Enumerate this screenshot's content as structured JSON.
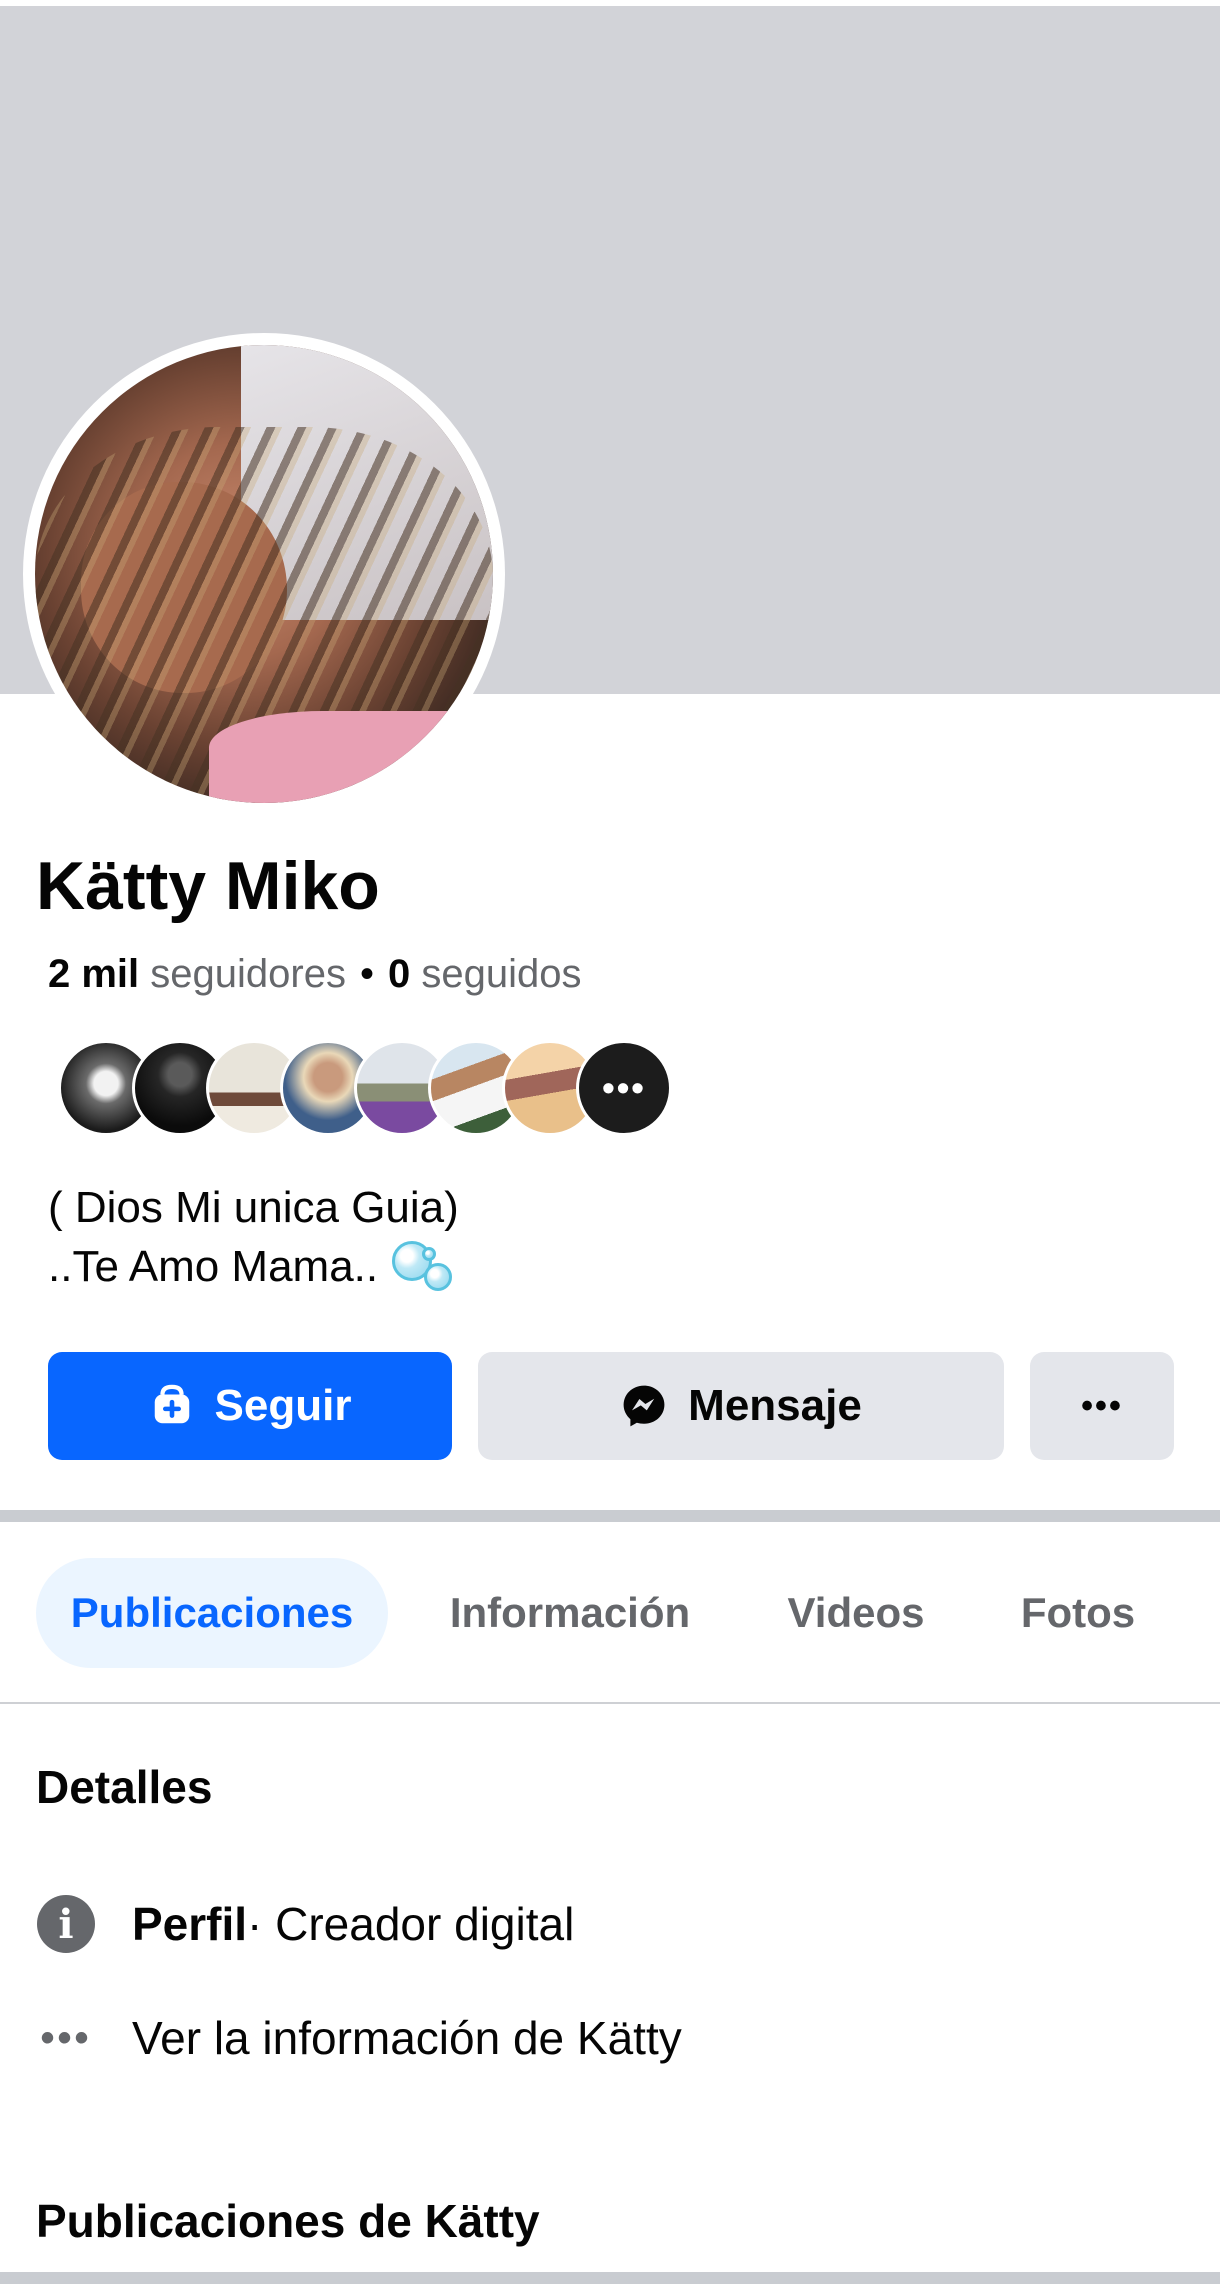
{
  "profile": {
    "name": "Kätty Miko",
    "followers_count": "2 mil",
    "followers_label": "seguidores",
    "separator": "•",
    "following_count": "0",
    "following_label": "seguidos",
    "bio_line1": "( Dios Mi unica Guia)",
    "bio_line2": "..Te Amo Mama.."
  },
  "friends_preview": {
    "more_label": "•••",
    "avatars": [
      "friend-avatar",
      "friend-avatar",
      "friend-avatar",
      "friend-avatar",
      "friend-avatar",
      "friend-avatar",
      "friend-avatar"
    ]
  },
  "actions": {
    "follow_label": "Seguir",
    "message_label": "Mensaje",
    "more_label": "•••"
  },
  "tabs": [
    {
      "label": "Publicaciones",
      "active": true
    },
    {
      "label": "Información",
      "active": false
    },
    {
      "label": "Videos",
      "active": false
    },
    {
      "label": "Fotos",
      "active": false
    }
  ],
  "details": {
    "title": "Detalles",
    "profile_bold": "Perfil",
    "profile_rest": " · Creador digital",
    "see_info": "Ver la información de Kätty"
  },
  "posts": {
    "title": "Publicaciones de Kätty"
  },
  "icons": {
    "follow": "person-add-icon",
    "message": "messenger-icon",
    "more": "more-dots-icon",
    "info": "info-icon",
    "see_more": "more-dots-icon"
  },
  "colors": {
    "accent": "#0866ff",
    "cover": "#d2d3d8",
    "button_secondary": "#e4e6eb",
    "tab_active_bg": "#ebf5ff",
    "secondary_text": "#65676b"
  }
}
